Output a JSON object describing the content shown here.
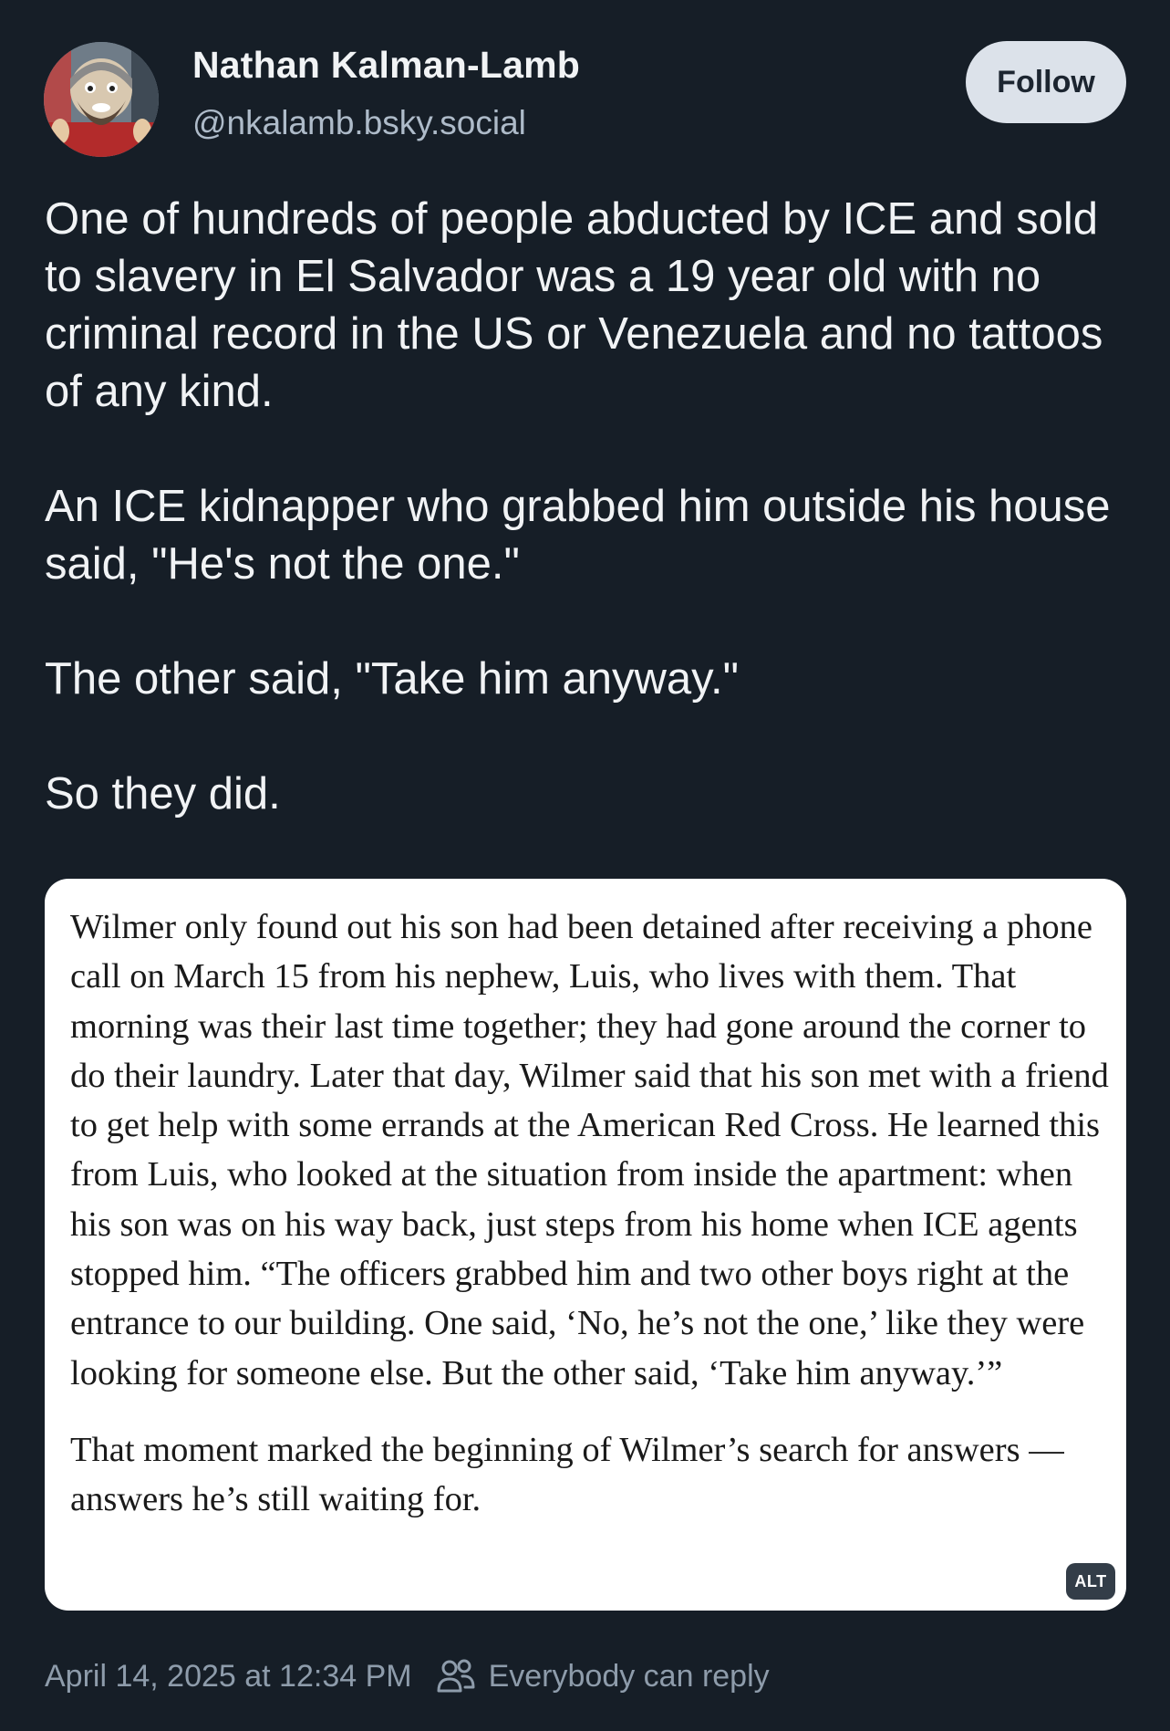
{
  "author": {
    "display_name": "Nathan Kalman-Lamb",
    "handle": "@nkalamb.bsky.social"
  },
  "follow_button": {
    "label": "Follow"
  },
  "post": {
    "paragraphs": [
      "One of hundreds of people abducted by ICE and sold to slavery in El Salvador was a 19 year old with no criminal record in the US or Venezuela and no tattoos of any kind.",
      "An ICE kidnapper who grabbed him outside his house said, \"He's not the one.\"",
      "The other said, \"Take him anyway.\"",
      "So they did."
    ]
  },
  "embedded_image": {
    "paragraphs": [
      "Wilmer only found out his son had been detained after receiving a phone call on March 15 from his nephew, Luis, who lives with them. That morning was their last time together; they had gone around the corner to do their laundry. Later that day, Wilmer said that his son met with a friend to get help with some errands at the American Red Cross. He learned this from Luis, who looked at the situation from inside the apartment: when his son was on his way back, just steps from his home when ICE agents stopped him. “The officers grabbed him and two other boys right at the entrance to our building. One said, ‘No, he’s not the one,’ like they were looking for someone else. But the other said, ‘Take him anyway.’”",
      "That moment marked the beginning of Wilmer’s search for answers — answers he’s still waiting for."
    ],
    "alt_badge": "ALT"
  },
  "meta": {
    "timestamp": "April 14, 2025 at 12:34 PM",
    "reply_setting": "Everybody can reply",
    "reply_icon": "people-icon"
  },
  "colors": {
    "background": "#161e27",
    "text_primary": "#f1f3f5",
    "text_secondary": "#8e9cab",
    "follow_bg": "#dce2ea"
  }
}
